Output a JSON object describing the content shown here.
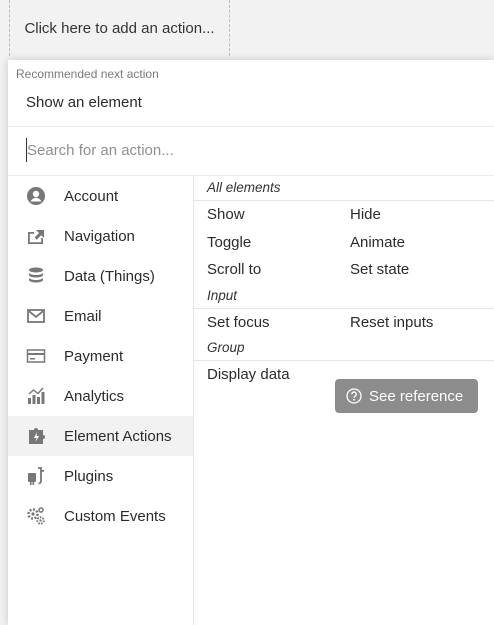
{
  "add_action": {
    "label": "Click here to add an action..."
  },
  "recommended": {
    "heading": "Recommended next action",
    "item": "Show an element"
  },
  "search": {
    "placeholder": "Search for an action..."
  },
  "categories": [
    {
      "label": "Account",
      "icon": "account-icon"
    },
    {
      "label": "Navigation",
      "icon": "navigation-icon"
    },
    {
      "label": "Data (Things)",
      "icon": "database-icon"
    },
    {
      "label": "Email",
      "icon": "email-icon"
    },
    {
      "label": "Payment",
      "icon": "credit-card-icon"
    },
    {
      "label": "Analytics",
      "icon": "analytics-icon"
    },
    {
      "label": "Element Actions",
      "icon": "element-actions-icon",
      "selected": true
    },
    {
      "label": "Plugins",
      "icon": "plugins-icon"
    },
    {
      "label": "Custom Events",
      "icon": "gears-icon"
    }
  ],
  "groups": {
    "all_elements": {
      "title": "All elements",
      "actions": [
        "Show",
        "Hide",
        "Toggle",
        "Animate",
        "Scroll to",
        "Set state"
      ]
    },
    "input": {
      "title": "Input",
      "actions": [
        "Set focus",
        "Reset inputs"
      ]
    },
    "group": {
      "title": "Group",
      "actions": [
        "Display data"
      ]
    }
  },
  "tooltip": {
    "label": "See reference",
    "icon": "help-circle-icon"
  },
  "colors": {
    "text": "#2b2b2b",
    "muted": "#7a7a7a",
    "selected_bg": "#f2f2f2",
    "tooltip_bg": "#8c8c8c"
  }
}
